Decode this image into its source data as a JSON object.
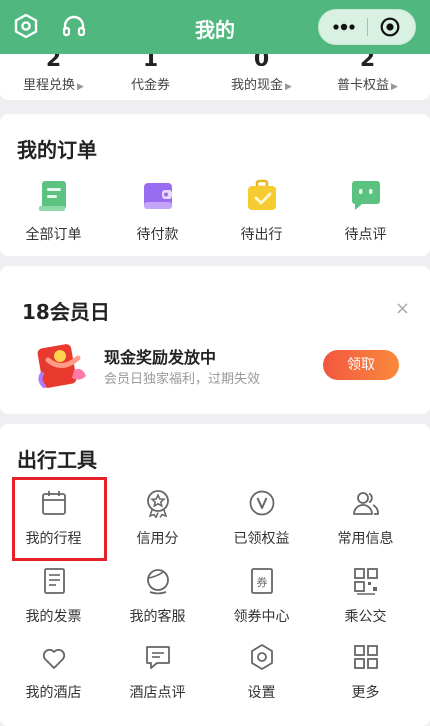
{
  "header": {
    "title": "我的"
  },
  "stats": [
    {
      "num": "2",
      "label": "里程兑换"
    },
    {
      "num": "1",
      "label": "代金券"
    },
    {
      "num": "0",
      "label": "我的现金"
    },
    {
      "num": "2",
      "label": "普卡权益"
    }
  ],
  "orders": {
    "title": "我的订单",
    "items": [
      {
        "label": "全部订单",
        "icon": "all-orders-icon"
      },
      {
        "label": "待付款",
        "icon": "wallet-icon"
      },
      {
        "label": "待出行",
        "icon": "suitcase-icon"
      },
      {
        "label": "待点评",
        "icon": "review-chat-icon"
      }
    ]
  },
  "promo": {
    "title": "18会员日",
    "main": "现金奖励发放中",
    "sub": "会员日独家福利，过期失效",
    "button": "领取",
    "close": "×"
  },
  "tools": {
    "title": "出行工具",
    "items": [
      {
        "label": "我的行程",
        "icon": "calendar-icon"
      },
      {
        "label": "信用分",
        "icon": "credit-badge-icon"
      },
      {
        "label": "已领权益",
        "icon": "v-circle-icon"
      },
      {
        "label": "常用信息",
        "icon": "people-icon"
      },
      {
        "label": "我的发票",
        "icon": "invoice-icon"
      },
      {
        "label": "我的客服",
        "icon": "support-icon"
      },
      {
        "label": "领券中心",
        "icon": "coupon-icon"
      },
      {
        "label": "乘公交",
        "icon": "bus-code-icon"
      },
      {
        "label": "我的酒店",
        "icon": "heart-icon"
      },
      {
        "label": "酒店点评",
        "icon": "hotel-review-icon"
      },
      {
        "label": "设置",
        "icon": "settings-icon"
      },
      {
        "label": "更多",
        "icon": "grid-more-icon"
      }
    ]
  },
  "colors": {
    "brand": "#50b87e",
    "highlight": "#e5222a",
    "button": "#f2573f"
  }
}
